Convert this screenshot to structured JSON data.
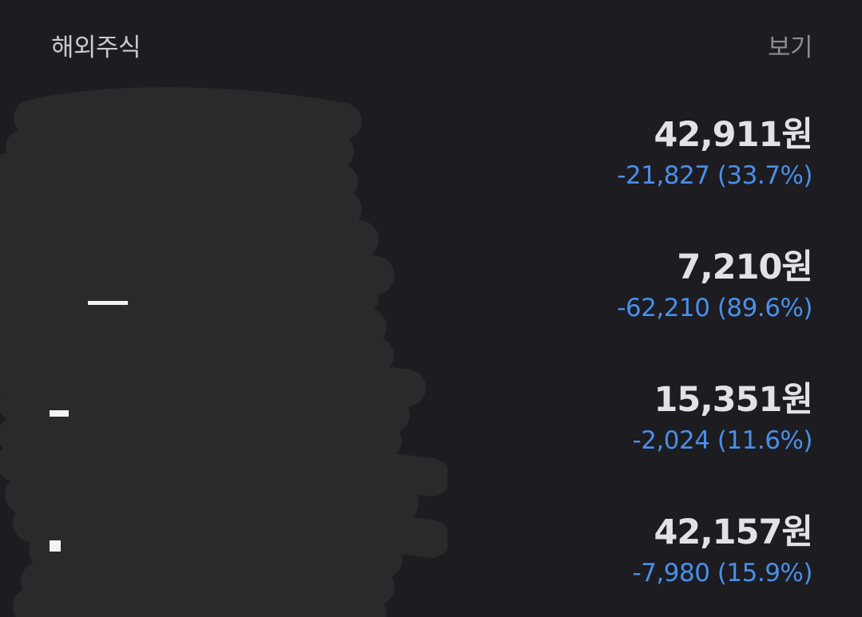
{
  "header": {
    "title": "해외주식",
    "view_label": "보기"
  },
  "stocks": [
    {
      "price": "42,911원",
      "change": "-21,827 (33.7%)"
    },
    {
      "price": "7,210원",
      "change": "-62,210 (89.6%)"
    },
    {
      "price": "15,351원",
      "change": "-2,024 (11.6%)"
    },
    {
      "price": "42,157원",
      "change": "-7,980 (15.9%)"
    }
  ],
  "colors": {
    "background": "#1c1c21",
    "loss": "#4a8fe8",
    "price": "#e2e2e6",
    "title": "#c9c9cf",
    "view_link": "#8c8c94",
    "scribble": "#2a2a2c"
  }
}
